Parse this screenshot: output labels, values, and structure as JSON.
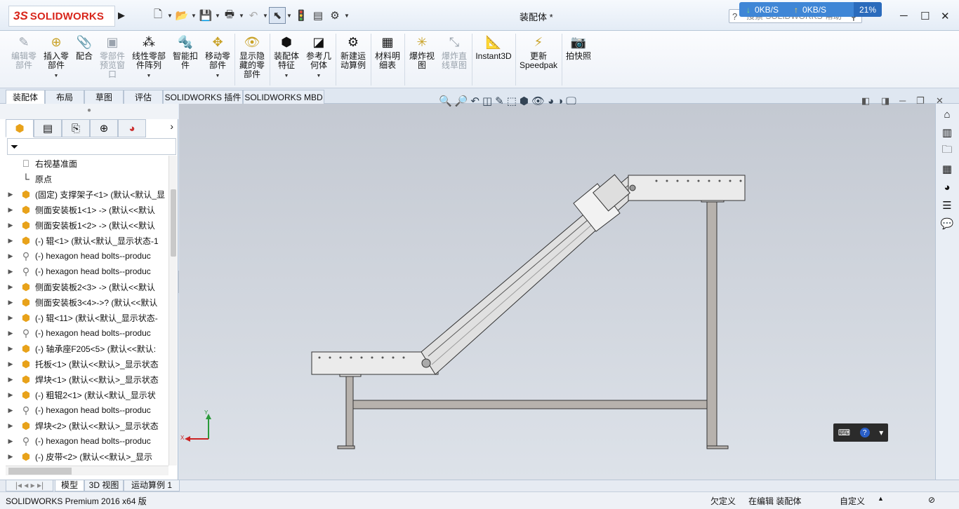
{
  "window": {
    "doc_title": "装配体 *",
    "brand_mark": "3S",
    "brand_name": "SOLIDWORKS",
    "minimize": "─",
    "maximize": "☐",
    "close": "✕"
  },
  "quick_access": {
    "icons": [
      "new-icon",
      "open-icon",
      "save-icon",
      "print-icon",
      "undo-icon",
      "select-icon",
      "rebuild-icon",
      "file-properties-icon",
      "options-icon"
    ]
  },
  "network_monitor": {
    "down": "0KB/S",
    "up": "0KB/S",
    "percent": "21%"
  },
  "search": {
    "placeholder": "搜索 SOLIDWORKS 帮助"
  },
  "ribbon": {
    "buttons": [
      {
        "label": "编辑零\n部件",
        "disabled": true,
        "icon": "edit-component-icon"
      },
      {
        "label": "插入零\n部件",
        "disabled": false,
        "icon": "insert-component-icon"
      },
      {
        "label": "配合",
        "disabled": false,
        "icon": "mate-icon"
      },
      {
        "label": "零部件\n预览窗\n口",
        "disabled": true,
        "icon": "preview-window-icon"
      },
      {
        "label": "线性零部\n件阵列",
        "disabled": false,
        "icon": "linear-pattern-icon"
      },
      {
        "label": "智能扣\n件",
        "disabled": false,
        "icon": "smart-fasteners-icon"
      },
      {
        "label": "移动零\n部件",
        "disabled": false,
        "icon": "move-component-icon"
      },
      {
        "label": "显示隐\n藏的零\n部件",
        "disabled": false,
        "icon": "show-hidden-icon"
      },
      {
        "label": "装配体\n特征",
        "disabled": false,
        "icon": "assembly-features-icon"
      },
      {
        "label": "参考几\n何体",
        "disabled": false,
        "icon": "reference-geometry-icon"
      },
      {
        "label": "新建运\n动算例",
        "disabled": false,
        "icon": "motion-study-icon"
      },
      {
        "label": "材料明\n细表",
        "disabled": false,
        "icon": "bom-icon"
      },
      {
        "label": "爆炸视\n图",
        "disabled": false,
        "icon": "exploded-view-icon"
      },
      {
        "label": "爆炸直\n线草图",
        "disabled": true,
        "icon": "explode-line-icon"
      },
      {
        "label": "Instant3D",
        "disabled": false,
        "icon": "instant3d-icon"
      },
      {
        "label": "更新\nSpeedpak",
        "disabled": false,
        "icon": "speedpak-icon"
      },
      {
        "label": "拍快照",
        "disabled": false,
        "icon": "snapshot-icon"
      }
    ]
  },
  "command_tabs": [
    "装配体",
    "布局",
    "草图",
    "评估",
    "SOLIDWORKS 插件",
    "SOLIDWORKS MBD"
  ],
  "feature_tree": {
    "items": [
      {
        "label": "右视基准面",
        "type": "plane",
        "expandable": false
      },
      {
        "label": "原点",
        "type": "origin",
        "expandable": false
      },
      {
        "label": "(固定) 支撑架子<1> (默认<默认_显",
        "type": "part",
        "expandable": true
      },
      {
        "label": "侧面安装板1<1> -> (默认<<默认",
        "type": "asm",
        "expandable": true
      },
      {
        "label": "侧面安装板1<2> -> (默认<<默认",
        "type": "asm",
        "expandable": true
      },
      {
        "label": "(-) 辊<1> (默认<默认_显示状态-1",
        "type": "part",
        "expandable": true
      },
      {
        "label": "(-) hexagon head bolts--produc",
        "type": "bolt",
        "expandable": true
      },
      {
        "label": "(-) hexagon head bolts--produc",
        "type": "bolt",
        "expandable": true
      },
      {
        "label": "侧面安装板2<3> -> (默认<<默认",
        "type": "asm",
        "expandable": true
      },
      {
        "label": "侧面安装板3<4>->? (默认<<默认",
        "type": "asm",
        "expandable": true
      },
      {
        "label": "(-) 辊<11> (默认<默认_显示状态-",
        "type": "part",
        "expandable": true
      },
      {
        "label": "(-) hexagon head bolts--produc",
        "type": "bolt",
        "expandable": true
      },
      {
        "label": "(-) 轴承座F205<5> (默认<<默认:",
        "type": "asm",
        "expandable": true
      },
      {
        "label": "托板<1> (默认<<默认>_显示状态",
        "type": "asm",
        "expandable": true
      },
      {
        "label": "焊块<1> (默认<<默认>_显示状态",
        "type": "asm",
        "expandable": true
      },
      {
        "label": "(-) 粗辊2<1> (默认<默认_显示状",
        "type": "part",
        "expandable": true
      },
      {
        "label": "(-) hexagon head bolts--produc",
        "type": "bolt",
        "expandable": true
      },
      {
        "label": "焊块<2> (默认<<默认>_显示状态",
        "type": "asm",
        "expandable": true
      },
      {
        "label": "(-) hexagon head bolts--produc",
        "type": "bolt",
        "expandable": true
      },
      {
        "label": "(-) 皮带<2> (默认<<默认>_显示",
        "type": "asm",
        "expandable": true
      }
    ]
  },
  "bottom_tabs": [
    "模型",
    "3D 视图",
    "运动算例 1"
  ],
  "status": {
    "product": "SOLIDWORKS Premium 2016 x64 版",
    "state": "欠定义",
    "editing": "在编辑 装配体",
    "units": "自定义"
  },
  "triad": {
    "x": "X",
    "y": "Y"
  },
  "colors": {
    "accent": "#3f86d6",
    "brand": "#d8261c",
    "viewport_top": "#c4c9d2"
  }
}
